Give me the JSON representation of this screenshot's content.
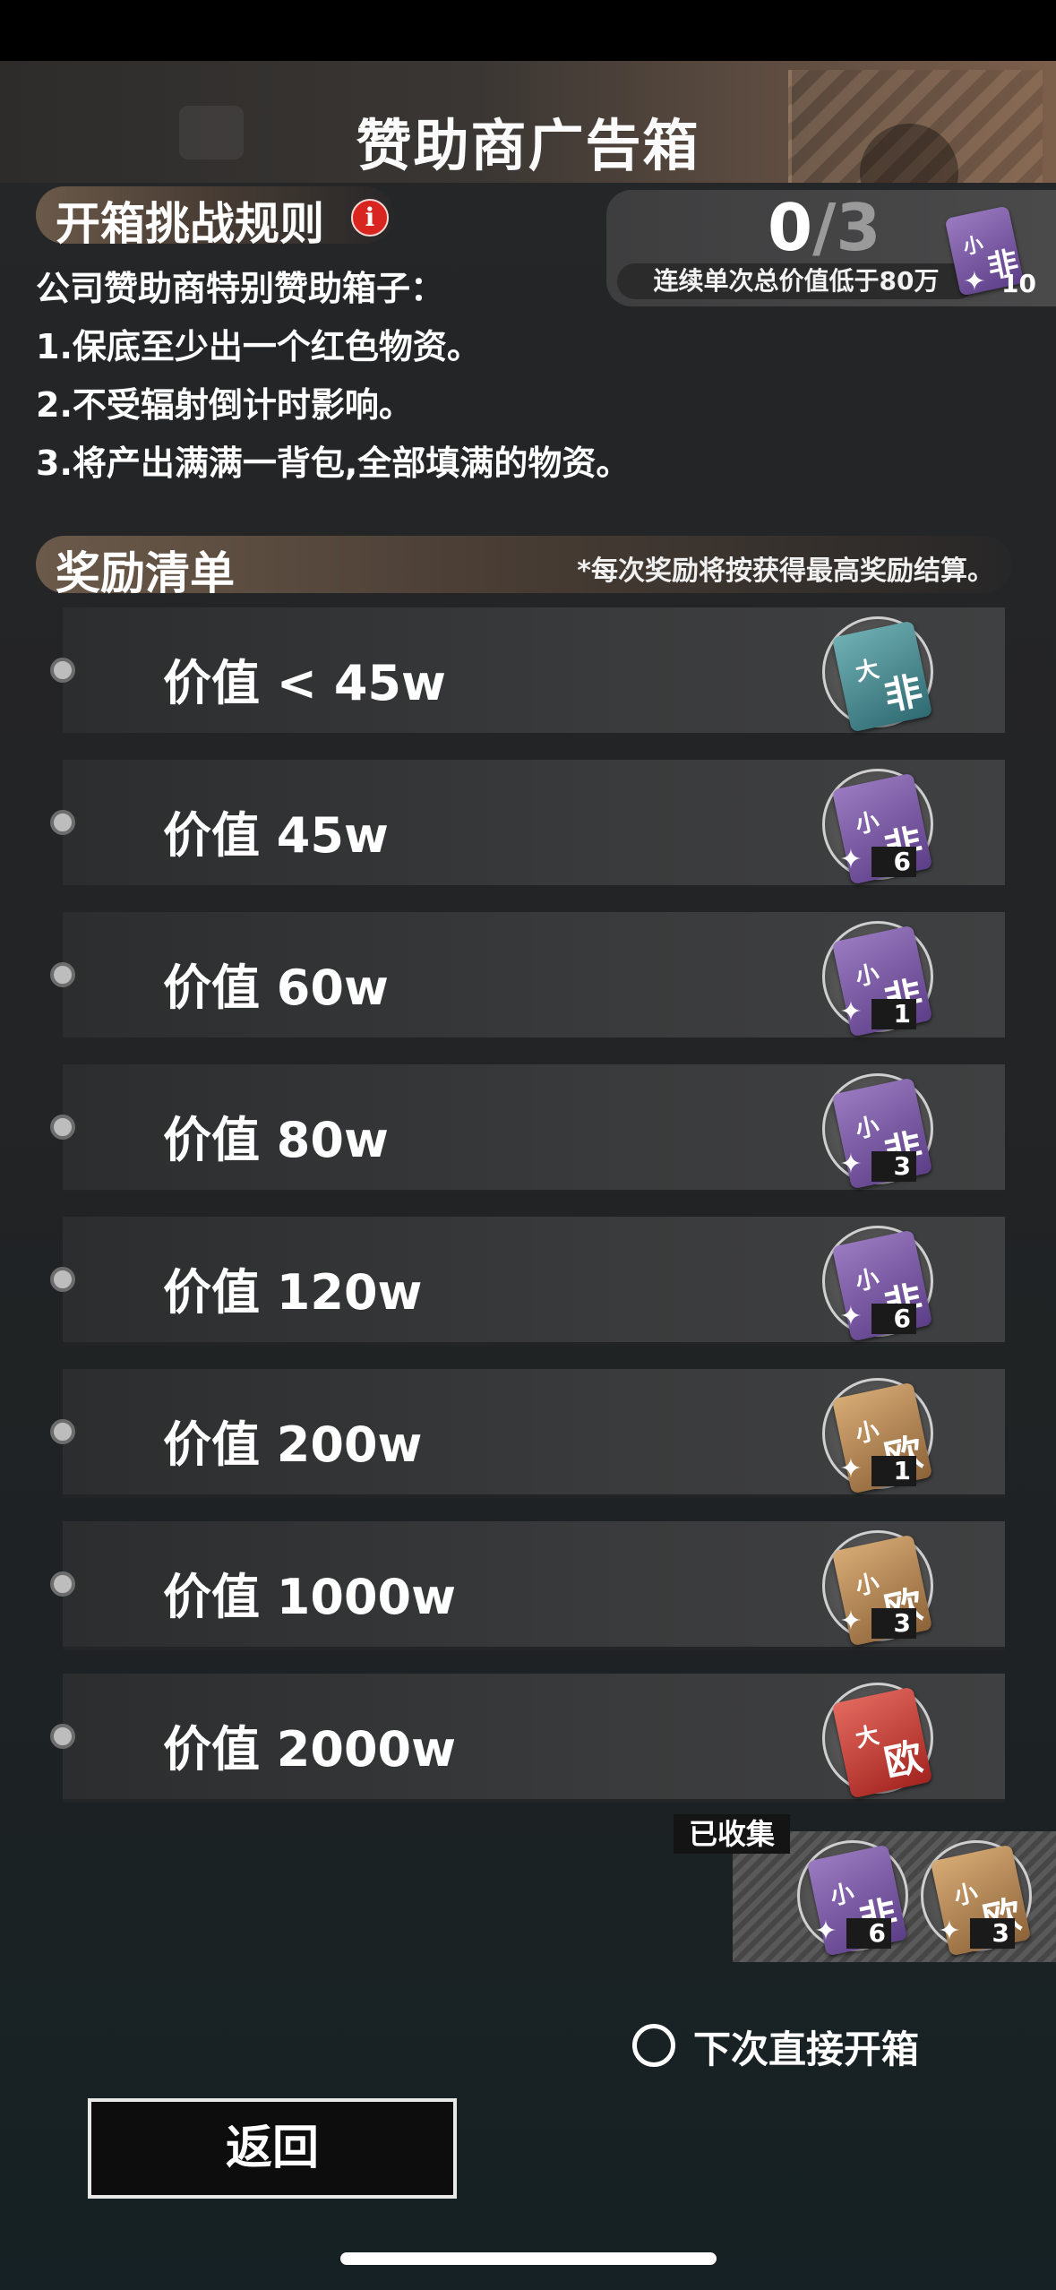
{
  "header": {
    "title": "赞助商广告箱"
  },
  "rules": {
    "tab_label": "开箱挑战规则",
    "lines": [
      "公司赞助商特别赞助箱子：",
      "1.保底至少出一个红色物资。",
      "2.不受辐射倒计时影响。",
      "3.将产出满满一背包,全部填满的物资。"
    ]
  },
  "challenge": {
    "done": "0",
    "slash": "/",
    "total": "3",
    "condition": "连续单次总价值低于80万",
    "reward_card": {
      "top": "小",
      "bottom": "非"
    },
    "reward_qty": "10"
  },
  "rewards": {
    "tab_label": "奖励清单",
    "note": "*每次奖励将按获得最高奖励结算。",
    "items": [
      {
        "label": "价值 < 45w",
        "card_top": "大",
        "card_bottom": "非",
        "qty": ""
      },
      {
        "label": "价值 45w",
        "card_top": "小",
        "card_bottom": "非",
        "qty": "6"
      },
      {
        "label": "价值 60w",
        "card_top": "小",
        "card_bottom": "非",
        "qty": "1"
      },
      {
        "label": "价值 80w",
        "card_top": "小",
        "card_bottom": "非",
        "qty": "3"
      },
      {
        "label": "价值 120w",
        "card_top": "小",
        "card_bottom": "非",
        "qty": "6"
      },
      {
        "label": "价值 200w",
        "card_top": "小",
        "card_bottom": "欧",
        "qty": "1"
      },
      {
        "label": "价值 1000w",
        "card_top": "小",
        "card_bottom": "欧",
        "qty": "3"
      },
      {
        "label": "价值 2000w",
        "card_top": "大",
        "card_bottom": "欧",
        "qty": ""
      }
    ]
  },
  "collected": {
    "label": "已收集",
    "items": [
      {
        "card_top": "小",
        "card_bottom": "非",
        "qty": "6"
      },
      {
        "card_top": "小",
        "card_bottom": "欧",
        "qty": "3"
      }
    ]
  },
  "options": {
    "direct_open_label": "下次直接开箱"
  },
  "actions": {
    "back_label": "返回"
  },
  "colors": {
    "card_purple": "#7a5aa6",
    "card_teal": "#4f8f94",
    "card_tan": "#b08454",
    "card_red": "#c9433a",
    "info_red": "#d9251f"
  }
}
